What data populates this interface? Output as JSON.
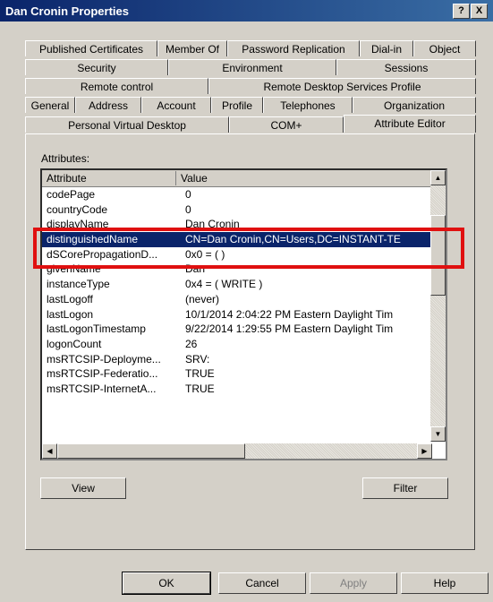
{
  "window": {
    "title": "Dan Cronin Properties",
    "help_glyph": "?",
    "close_glyph": "X"
  },
  "tabs": {
    "row1": [
      "Published Certificates",
      "Member Of",
      "Password Replication",
      "Dial-in",
      "Object"
    ],
    "row2": [
      "Security",
      "Environment",
      "Sessions"
    ],
    "row3": [
      "Remote control",
      "Remote Desktop Services Profile"
    ],
    "row4": [
      "General",
      "Address",
      "Account",
      "Profile",
      "Telephones",
      "Organization"
    ],
    "row5": [
      "Personal Virtual Desktop",
      "COM+",
      "Attribute Editor"
    ]
  },
  "attributes": {
    "label": "Attributes:",
    "columns": {
      "attribute": "Attribute",
      "value": "Value"
    },
    "rows": [
      {
        "name": "codePage",
        "value": "0"
      },
      {
        "name": "countryCode",
        "value": "0"
      },
      {
        "name": "displayName",
        "value": "Dan Cronin"
      },
      {
        "name": "distinguishedName",
        "value": "CN=Dan Cronin,CN=Users,DC=INSTANT-TE"
      },
      {
        "name": "dSCorePropagationD...",
        "value": "0x0 = ( )"
      },
      {
        "name": "givenName",
        "value": "Dan"
      },
      {
        "name": "instanceType",
        "value": "0x4 = ( WRITE )"
      },
      {
        "name": "lastLogoff",
        "value": "(never)"
      },
      {
        "name": "lastLogon",
        "value": "10/1/2014 2:04:22 PM Eastern Daylight Tim"
      },
      {
        "name": "lastLogonTimestamp",
        "value": "9/22/2014 1:29:55 PM Eastern Daylight Tim"
      },
      {
        "name": "logonCount",
        "value": "26"
      },
      {
        "name": "msRTCSIP-Deployme...",
        "value": "SRV:"
      },
      {
        "name": "msRTCSIP-Federatio...",
        "value": "TRUE"
      },
      {
        "name": "msRTCSIP-InternetA...",
        "value": "TRUE"
      }
    ],
    "selected_row": "distinguishedName"
  },
  "buttons": {
    "view": "View",
    "filter": "Filter",
    "ok": "OK",
    "cancel": "Cancel",
    "apply": "Apply",
    "help": "Help"
  },
  "colors": {
    "highlight_box": "#e01010",
    "selection": "#0a246a"
  },
  "icons": {
    "scroll_up": "▲",
    "scroll_down": "▼",
    "scroll_left": "◀",
    "scroll_right": "▶"
  }
}
